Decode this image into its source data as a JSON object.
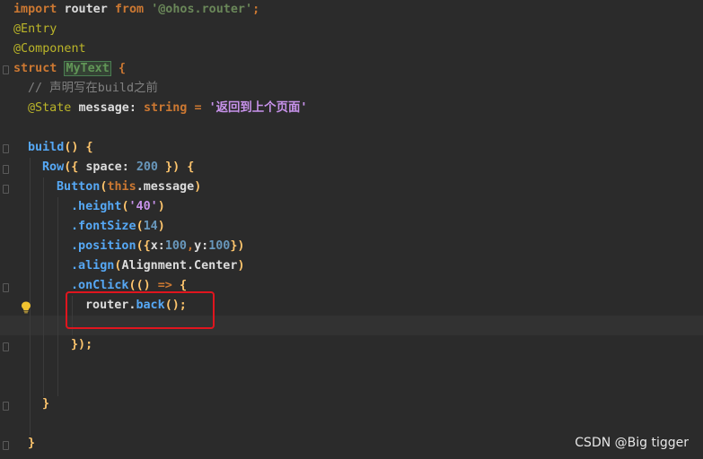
{
  "editor": {
    "lines": {
      "l1": {
        "kw": "import",
        "name": "router",
        "from": "from",
        "module": "'@ohos.router'",
        "semi": ";"
      },
      "l2": {
        "decorator": "@Entry"
      },
      "l3": {
        "decorator": "@Component"
      },
      "l4": {
        "kw": "struct",
        "name": "MyText",
        "brace": "{"
      },
      "l5": {
        "comment": "// 声明写在build之前"
      },
      "l6": {
        "decorator": "@State",
        "name": "message",
        "colon": ":",
        "type": "string",
        "eq": "=",
        "value": "'返回到上个页面'"
      },
      "l8": {
        "fn": "build",
        "rest": "() {"
      },
      "l9": {
        "fn": "Row",
        "open": "({ ",
        "key": "space",
        "colon": ": ",
        "num": "200",
        "close": " }) {"
      },
      "l10": {
        "fn": "Button",
        "open": "(",
        "this": "this",
        "member": ".message",
        "close": ")"
      },
      "l11": {
        "method": ".height",
        "open": "(",
        "arg": "'40'",
        "close": ")"
      },
      "l12": {
        "method": ".fontSize",
        "open": "(",
        "arg": "14",
        "close": ")"
      },
      "l13": {
        "method": ".position",
        "open": "({",
        "x": "x",
        "c1": ":",
        "xv": "100",
        "comma": ",",
        "y": "y",
        "c2": ":",
        "yv": "100",
        "close": "})"
      },
      "l14": {
        "method": ".align",
        "open": "(",
        "arg": "Alignment.Center",
        "close": ")"
      },
      "l15": {
        "method": ".onClick",
        "open": "(",
        "params": "()",
        "arrow": " => ",
        "brace": "{"
      },
      "l16": {
        "obj": "router",
        "dot": ".",
        "method": "back",
        "rest": "();"
      },
      "l18": {
        "text": "});"
      },
      "l21": {
        "text": "}"
      },
      "l23": {
        "text": "}"
      }
    }
  },
  "watermark": "CSDN @Big tigger",
  "icons": {
    "intention": "lightbulb-icon"
  }
}
